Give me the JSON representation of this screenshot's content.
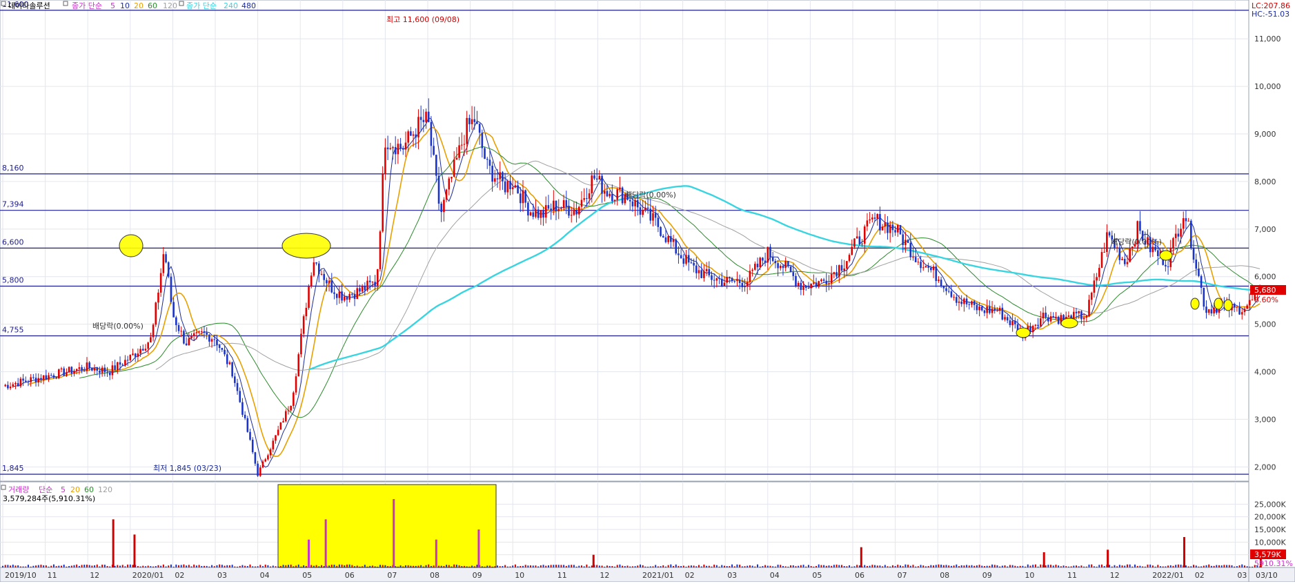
{
  "header": {
    "stock_name": "데이타솔루션",
    "ma_label": "종가 단순",
    "ma_periods": [
      "5",
      "10",
      "20",
      "60",
      "120"
    ],
    "ma_long_label": "종가 단순",
    "ma_long_periods": [
      "240",
      "480"
    ],
    "lc": "LC:207.86",
    "hc": "HC:-51.03"
  },
  "volume_header": {
    "label": "거래량",
    "ma_label": "단순",
    "ma_periods": [
      "5",
      "20",
      "60",
      "120"
    ],
    "value": "3,579,284주(5,910.31%)"
  },
  "annotations": {
    "high": "최고 11,600 (09/08)",
    "low": "최저 1,845 (03/23)",
    "dividend1": "배당락(0.00%)",
    "dividend2": "배당락(0.00%)",
    "dividend3": "배당락(0.00%)"
  },
  "current": {
    "price": "5,680",
    "change": "6.60%",
    "volume": "3,579K",
    "volume_pct": "5910.31%"
  },
  "colors": {
    "up": "#e00000",
    "down": "#1a33c8",
    "ma5": "#c832c8",
    "ma10": "#1a2a9a",
    "ma20": "#e8a000",
    "ma60": "#2a8a2a",
    "ma120": "#a0a0a0",
    "ma240": "#38d4e0",
    "hline": "#1c1c8c",
    "highlight": "#ffff00",
    "volume": "#d10000"
  },
  "chart_data": {
    "type": "candlestick",
    "x_ticks": [
      "2019/10",
      "11",
      "12",
      "2020/01",
      "02",
      "03",
      "04",
      "05",
      "06",
      "07",
      "08",
      "09",
      "10",
      "11",
      "12",
      "2021/01",
      "02",
      "03",
      "04",
      "05",
      "06",
      "07",
      "08",
      "09",
      "10",
      "11",
      "12",
      "2022/01",
      "02",
      "03",
      "03/10"
    ],
    "y_ticks": [
      "11,000",
      "10,000",
      "9,000",
      "8,000",
      "7,000",
      "6,000",
      "5,000",
      "4,000",
      "3,000",
      "2,000"
    ],
    "ylim": [
      1700,
      11700
    ],
    "horizontal_lines": [
      {
        "value": 11600,
        "label": "11,600"
      },
      {
        "value": 8160,
        "label": "8,160"
      },
      {
        "value": 7394,
        "label": "7,394"
      },
      {
        "value": 6600,
        "label": "6,600"
      },
      {
        "value": 5800,
        "label": "5,800"
      },
      {
        "value": 4755,
        "label": "4,755"
      },
      {
        "value": 1845,
        "label": "1,845"
      }
    ],
    "price_path": [
      [
        0,
        3700
      ],
      [
        1,
        3900
      ],
      [
        2,
        4100
      ],
      [
        2.5,
        4000
      ],
      [
        3,
        4300
      ],
      [
        3.5,
        4700
      ],
      [
        3.8,
        6600
      ],
      [
        4,
        5200
      ],
      [
        4.3,
        4600
      ],
      [
        4.7,
        4800
      ],
      [
        5,
        4700
      ],
      [
        5.4,
        4000
      ],
      [
        5.8,
        2600
      ],
      [
        6,
        1845
      ],
      [
        6.4,
        2600
      ],
      [
        6.8,
        3400
      ],
      [
        7,
        4600
      ],
      [
        7.3,
        6400
      ],
      [
        7.7,
        5800
      ],
      [
        8,
        5600
      ],
      [
        8.4,
        5700
      ],
      [
        8.8,
        5900
      ],
      [
        9,
        8900
      ],
      [
        9.4,
        8700
      ],
      [
        9.8,
        9200
      ],
      [
        10,
        9300
      ],
      [
        10.3,
        7300
      ],
      [
        10.6,
        8200
      ],
      [
        10.9,
        9100
      ],
      [
        11.1,
        9300
      ],
      [
        11.4,
        8300
      ],
      [
        11.8,
        7900
      ],
      [
        12,
        8000
      ],
      [
        12.4,
        7400
      ],
      [
        12.7,
        7300
      ],
      [
        13,
        7500
      ],
      [
        13.5,
        7400
      ],
      [
        13.9,
        8100
      ],
      [
        14.2,
        7800
      ],
      [
        14.7,
        7700
      ],
      [
        15,
        7400
      ],
      [
        15.4,
        7100
      ],
      [
        15.8,
        6600
      ],
      [
        16.2,
        6200
      ],
      [
        16.6,
        6000
      ],
      [
        17,
        5900
      ],
      [
        17.5,
        5900
      ],
      [
        18,
        6500
      ],
      [
        18.4,
        6200
      ],
      [
        18.8,
        5800
      ],
      [
        19.3,
        5900
      ],
      [
        19.8,
        6300
      ],
      [
        20,
        6600
      ],
      [
        20.5,
        7200
      ],
      [
        21,
        7000
      ],
      [
        21.5,
        6400
      ],
      [
        22,
        6000
      ],
      [
        22.5,
        5500
      ],
      [
        23,
        5300
      ],
      [
        23.4,
        5300
      ],
      [
        24,
        4800
      ],
      [
        24.5,
        5200
      ],
      [
        25,
        5100
      ],
      [
        25.5,
        5200
      ],
      [
        26,
        6900
      ],
      [
        26.4,
        6300
      ],
      [
        26.7,
        7000
      ],
      [
        27,
        6600
      ],
      [
        27.4,
        6300
      ],
      [
        27.8,
        7400
      ],
      [
        28,
        6600
      ],
      [
        28.3,
        5300
      ],
      [
        28.7,
        5400
      ],
      [
        29,
        5300
      ],
      [
        29.3,
        5400
      ],
      [
        29.6,
        5680
      ]
    ],
    "volume_peaks": [
      {
        "x": 2.6,
        "value": 19000
      },
      {
        "x": 3.1,
        "value": 13000
      },
      {
        "x": 7.2,
        "value": 11000
      },
      {
        "x": 7.6,
        "value": 19000
      },
      {
        "x": 9.2,
        "value": 27000
      },
      {
        "x": 10.2,
        "value": 11000
      },
      {
        "x": 11.2,
        "value": 15000
      },
      {
        "x": 13.9,
        "value": 5000
      },
      {
        "x": 20.2,
        "value": 8000
      },
      {
        "x": 24.5,
        "value": 6000
      },
      {
        "x": 26,
        "value": 7000
      },
      {
        "x": 27.8,
        "value": 12000
      },
      {
        "x": 29.6,
        "value": 3579
      }
    ],
    "volume_ticks": [
      "25,000K",
      "20,000K",
      "15,000K",
      "10,000K",
      "5,000K"
    ],
    "volume_ylim": [
      0,
      30000
    ]
  }
}
